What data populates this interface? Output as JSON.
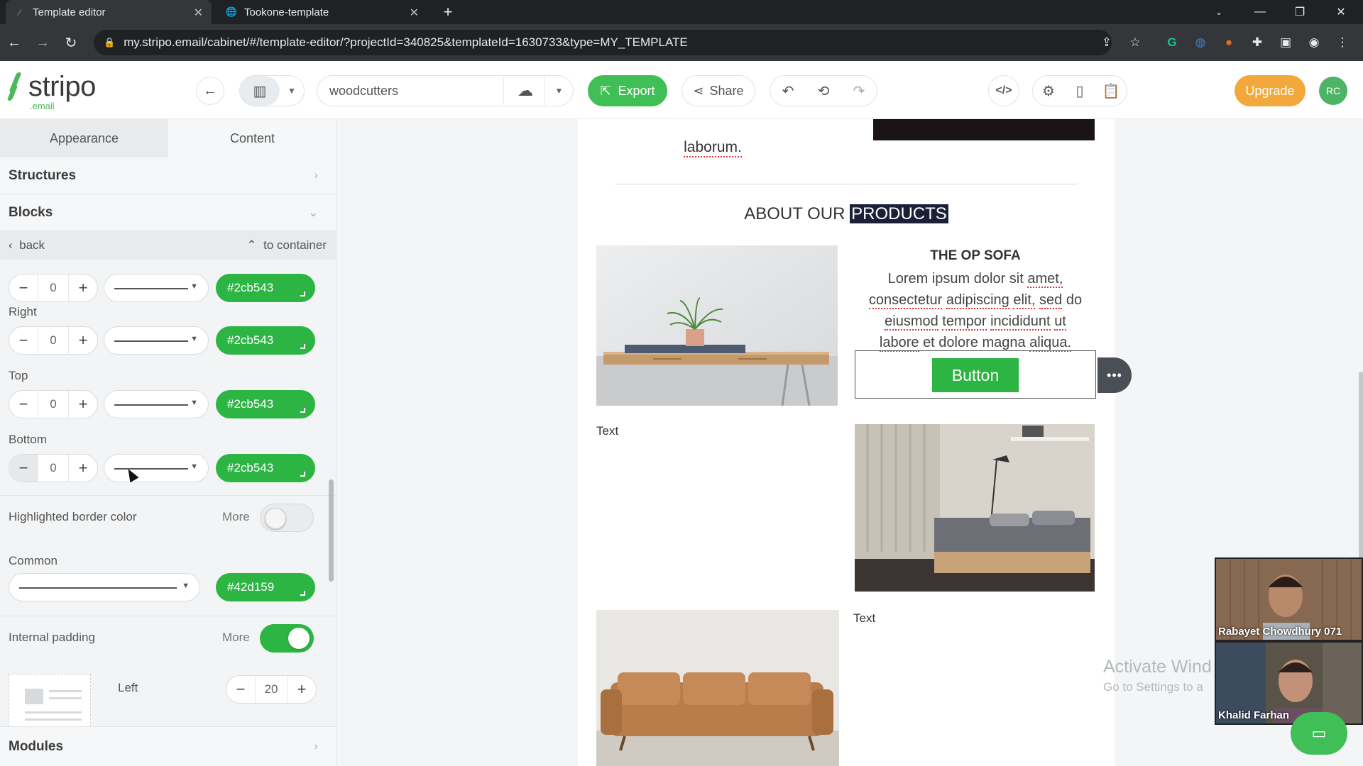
{
  "browser": {
    "tabs": [
      {
        "title": "Template editor",
        "active": true
      },
      {
        "title": "Tookone-template",
        "active": false
      }
    ],
    "url": "my.stripo.email/cabinet/#/template-editor/?projectId=340825&templateId=1630733&type=MY_TEMPLATE"
  },
  "toolbar": {
    "logo": "stripo",
    "logo_sub": ".email",
    "template_name": "woodcutters",
    "export_label": "Export",
    "share_label": "Share",
    "upgrade_label": "Upgrade",
    "avatar_initials": "RC",
    "accent_color": "#3fbf55",
    "upgrade_color": "#f3a83c"
  },
  "panel": {
    "tabs": [
      "Appearance",
      "Content"
    ],
    "structures": "Structures",
    "blocks": "Blocks",
    "back": "back",
    "to_container": "to container",
    "borders": [
      {
        "label": "",
        "value": "0",
        "color": "#2cb543"
      },
      {
        "label": "Right",
        "value": "0",
        "color": "#2cb543"
      },
      {
        "label": "Top",
        "value": "0",
        "color": "#2cb543"
      },
      {
        "label": "Bottom",
        "value": "0",
        "color": "#2cb543"
      }
    ],
    "highlighted_border_label": "Highlighted border color",
    "more_label": "More",
    "highlighted_border_on": false,
    "common_label": "Common",
    "common_color": "#42d159",
    "internal_padding_label": "Internal padding",
    "internal_padding_on": true,
    "left_label": "Left",
    "left_value": "20",
    "modules": "Modules"
  },
  "email": {
    "prev_text": "laborum.",
    "section_title_prefix": "ABOUT OUR ",
    "section_title_highlight": "PRODUCTS",
    "product_title": "THE OP SOFA",
    "product_desc": {
      "w1": "Lorem ipsum dolor sit",
      "w2": "amet,",
      "w3": "consectetur",
      "w4": "adipiscing",
      "w5": "elit,",
      "w6": "sed",
      "w7": "do",
      "w8": "eiusmod",
      "w9": "tempor",
      "w10": "incididunt",
      "w11": "ut",
      "w12": "labore",
      "w13": "et dolore magna",
      "w14": "aliqua."
    },
    "button_label": "Button",
    "text_1": "Text",
    "text_2": "Text"
  },
  "overlay": {
    "watermark_line1": "Activate Wind",
    "watermark_line2": "Go to Settings to a",
    "participants": [
      "Rabayet Chowdhury 071",
      "Khalid Farhan"
    ]
  }
}
